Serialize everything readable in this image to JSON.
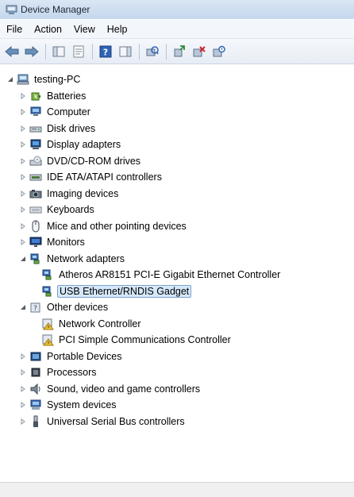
{
  "window": {
    "title": "Device Manager"
  },
  "menu": [
    "File",
    "Action",
    "View",
    "Help"
  ],
  "toolbar": {
    "buttons": [
      "back-arrow-icon",
      "forward-arrow-icon",
      "show-hide-tree-icon",
      "properties-icon",
      "help-icon",
      "action-pane-icon",
      "scan-hardware-icon",
      "update-driver-icon",
      "uninstall-device-icon",
      "disable-device-icon"
    ]
  },
  "tree": {
    "root": "testing-PC",
    "nodes": [
      {
        "label": "Batteries",
        "icon": "battery-icon",
        "level": 1,
        "expander": "collapsed"
      },
      {
        "label": "Computer",
        "icon": "computer-icon",
        "level": 1,
        "expander": "collapsed"
      },
      {
        "label": "Disk drives",
        "icon": "disk-drive-icon",
        "level": 1,
        "expander": "collapsed"
      },
      {
        "label": "Display adapters",
        "icon": "display-adapter-icon",
        "level": 1,
        "expander": "collapsed"
      },
      {
        "label": "DVD/CD-ROM drives",
        "icon": "dvd-drive-icon",
        "level": 1,
        "expander": "collapsed"
      },
      {
        "label": "IDE ATA/ATAPI controllers",
        "icon": "ide-controller-icon",
        "level": 1,
        "expander": "collapsed"
      },
      {
        "label": "Imaging devices",
        "icon": "imaging-device-icon",
        "level": 1,
        "expander": "collapsed"
      },
      {
        "label": "Keyboards",
        "icon": "keyboard-icon",
        "level": 1,
        "expander": "collapsed"
      },
      {
        "label": "Mice and other pointing devices",
        "icon": "mouse-icon",
        "level": 1,
        "expander": "collapsed"
      },
      {
        "label": "Monitors",
        "icon": "monitor-icon",
        "level": 1,
        "expander": "collapsed"
      },
      {
        "label": "Network adapters",
        "icon": "network-adapter-icon",
        "level": 1,
        "expander": "expanded"
      },
      {
        "label": "Atheros AR8151 PCI-E Gigabit Ethernet Controller",
        "icon": "network-adapter-icon",
        "level": 2,
        "expander": "none"
      },
      {
        "label": "USB Ethernet/RNDIS Gadget",
        "icon": "network-adapter-icon",
        "level": 2,
        "expander": "none",
        "selected": true
      },
      {
        "label": "Other devices",
        "icon": "other-devices-icon",
        "level": 1,
        "expander": "expanded"
      },
      {
        "label": "Network Controller",
        "icon": "unknown-device-warning-icon",
        "level": 2,
        "expander": "none"
      },
      {
        "label": "PCI Simple Communications Controller",
        "icon": "unknown-device-warning-icon",
        "level": 2,
        "expander": "none"
      },
      {
        "label": "Portable Devices",
        "icon": "portable-device-icon",
        "level": 1,
        "expander": "collapsed"
      },
      {
        "label": "Processors",
        "icon": "processor-icon",
        "level": 1,
        "expander": "collapsed"
      },
      {
        "label": "Sound, video and game controllers",
        "icon": "sound-icon",
        "level": 1,
        "expander": "collapsed"
      },
      {
        "label": "System devices",
        "icon": "system-device-icon",
        "level": 1,
        "expander": "collapsed"
      },
      {
        "label": "Universal Serial Bus controllers",
        "icon": "usb-icon",
        "level": 1,
        "expander": "collapsed"
      }
    ]
  },
  "colors": {
    "selection_fill": "#d5e8fb",
    "selection_border": "#7da2ce",
    "titlebar": "#c9dbef"
  }
}
